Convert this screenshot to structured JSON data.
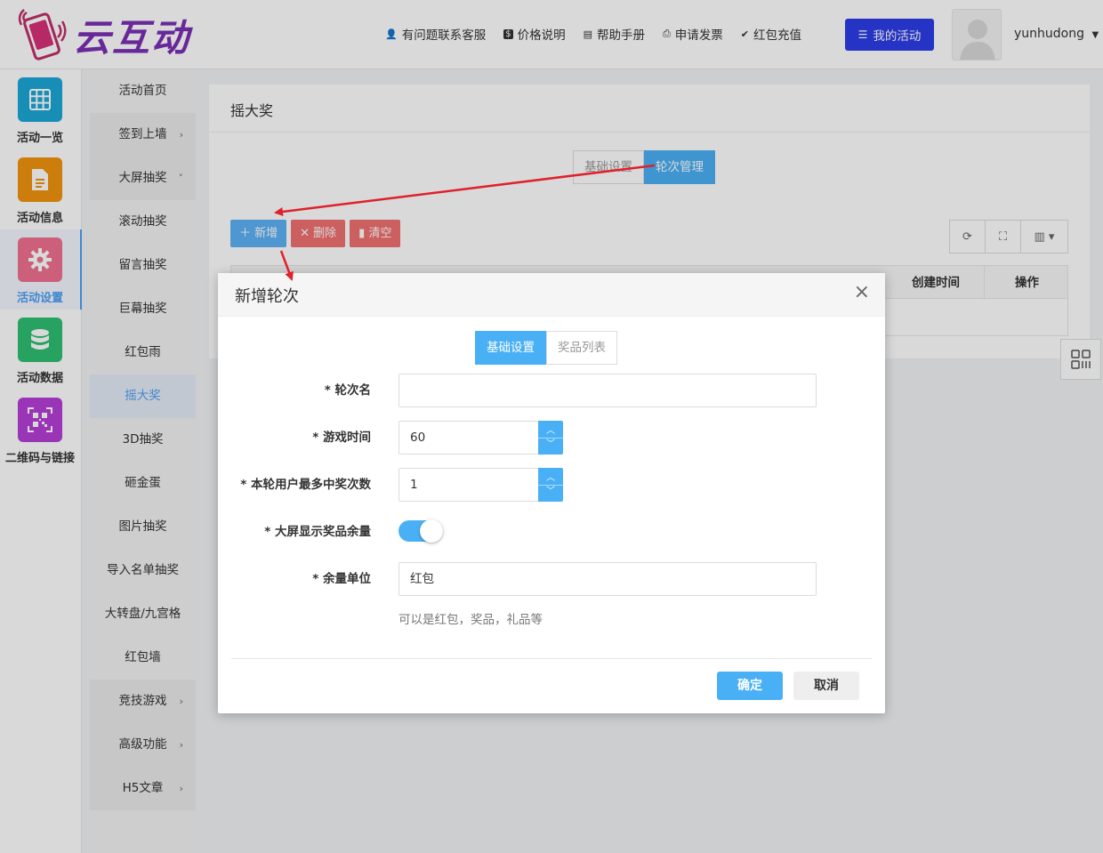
{
  "brand": {
    "logo_text": "云互动"
  },
  "topnav": [
    {
      "icon": "user-plus-icon",
      "glyph": "👤",
      "label": "有问题联系客服"
    },
    {
      "icon": "dollar-icon",
      "glyph": "$",
      "label": "价格说明"
    },
    {
      "icon": "book-icon",
      "glyph": "▤",
      "label": "帮助手册"
    },
    {
      "icon": "printer-icon",
      "glyph": "⎙",
      "label": "申请发票"
    },
    {
      "icon": "shield-check-icon",
      "glyph": "✔",
      "label": "红包充值"
    }
  ],
  "my_activity": {
    "label": "我的活动"
  },
  "user": {
    "name": "yunhudong"
  },
  "iconbar": [
    {
      "label": "活动一览",
      "color": "#1aa7d6"
    },
    {
      "label": "活动信息",
      "color": "#f0930e"
    },
    {
      "label": "活动设置",
      "color": "#f07090"
    },
    {
      "label": "活动数据",
      "color": "#2fbf72"
    },
    {
      "label": "二维码与链接",
      "color": "#b43fd6"
    }
  ],
  "submenu": [
    {
      "label": "活动首页"
    },
    {
      "label": "签到上墙",
      "arrow": "›"
    },
    {
      "label": "大屏抽奖",
      "arrow": "˅"
    },
    {
      "label": "滚动抽奖"
    },
    {
      "label": "留言抽奖"
    },
    {
      "label": "巨幕抽奖"
    },
    {
      "label": "红包雨"
    },
    {
      "label": "摇大奖"
    },
    {
      "label": "3D抽奖"
    },
    {
      "label": "砸金蛋"
    },
    {
      "label": "图片抽奖"
    },
    {
      "label": "导入名单抽奖"
    },
    {
      "label": "大转盘/九宫格"
    },
    {
      "label": "红包墙"
    },
    {
      "label": "竞技游戏",
      "arrow": "›"
    },
    {
      "label": "高级功能",
      "arrow": "›"
    },
    {
      "label": "H5文章",
      "arrow": "›"
    }
  ],
  "panel": {
    "title": "摇大奖",
    "tabs": [
      "基础设置",
      "轮次管理"
    ],
    "toolbar": {
      "add": "＋ 新增",
      "delete": "✕ 删除",
      "clear": "▮ 清空"
    },
    "table_headers": {
      "created": "创建时间",
      "actions": "操作"
    }
  },
  "modal": {
    "title": "新增轮次",
    "close": "×",
    "tabs": [
      "基础设置",
      "奖品列表"
    ],
    "fields": {
      "round_name": {
        "label": "* 轮次名",
        "value": ""
      },
      "game_time": {
        "label": "* 游戏时间",
        "value": "60"
      },
      "max_wins": {
        "label": "* 本轮用户最多中奖次数",
        "value": "1"
      },
      "show_remaining": {
        "label": "* 大屏显示奖品余量",
        "on": true
      },
      "unit": {
        "label": "* 余量单位",
        "value": "红包",
        "hint": "可以是红包，奖品，礼品等"
      }
    },
    "ok": "确定",
    "cancel": "取消"
  }
}
